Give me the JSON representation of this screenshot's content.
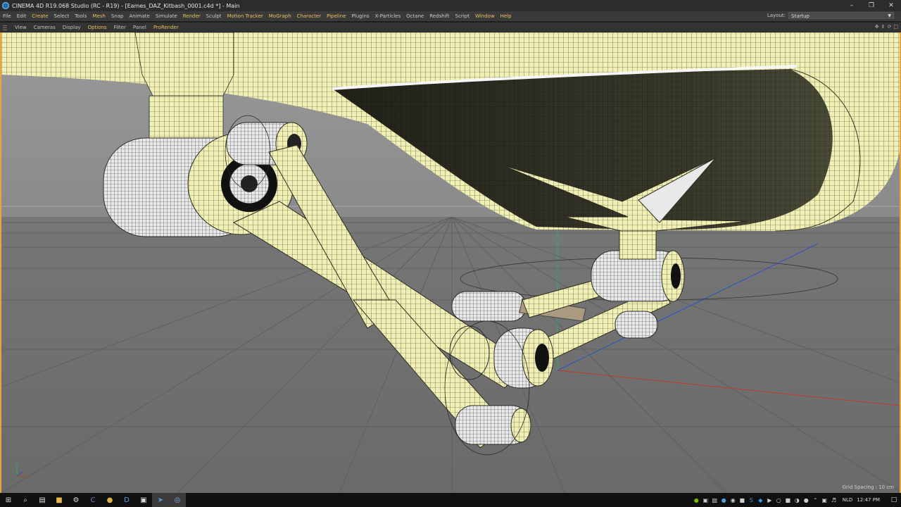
{
  "window": {
    "title": "CINEMA 4D R19.068 Studio (RC - R19) - [Eames_DAZ_Kitbash_0001.c4d *] - Main",
    "minimize": "–",
    "restore": "❐",
    "close": "✕"
  },
  "menubar": {
    "items": [
      "File",
      "Edit",
      "Create",
      "Select",
      "Tools",
      "Mesh",
      "Snap",
      "Animate",
      "Simulate",
      "Render",
      "Sculpt",
      "Motion Tracker",
      "MoGraph",
      "Character",
      "Pipeline",
      "Plugins",
      "X-Particles",
      "Octane",
      "Redshift",
      "Script",
      "Window",
      "Help"
    ],
    "layout_label": "Layout:",
    "layout_value": "Startup"
  },
  "viewport_menu": {
    "items": [
      "View",
      "Cameras",
      "Display",
      "Options",
      "Filter",
      "Panel",
      "ProRender"
    ]
  },
  "viewport": {
    "grid_spacing": "Grid Spacing : 10 cm",
    "axis_x_color": "#c0392b",
    "axis_y_color": "#27ae60",
    "axis_z_color": "#2f50c8",
    "mesh_color": "#f1f0b4"
  },
  "taskbar": {
    "apps": [
      {
        "name": "start-icon",
        "glyph": "⊞"
      },
      {
        "name": "search-icon",
        "glyph": "⌕"
      },
      {
        "name": "task-view-icon",
        "glyph": "▤"
      },
      {
        "name": "file-explorer-icon",
        "glyph": "■"
      },
      {
        "name": "settings-icon",
        "glyph": "⚙"
      },
      {
        "name": "app-c-icon",
        "glyph": "C"
      },
      {
        "name": "chrome-icon",
        "glyph": "●"
      },
      {
        "name": "daz-icon",
        "glyph": "D"
      },
      {
        "name": "window-app-icon",
        "glyph": "▣"
      },
      {
        "name": "telegram-icon",
        "glyph": "➤"
      },
      {
        "name": "cinema4d-icon",
        "glyph": "◎"
      }
    ],
    "tray_icons": [
      "nvidia-icon",
      "drive-icon",
      "app-icon",
      "app-icon",
      "steam-icon",
      "app-icon",
      "skype-icon",
      "dropbox-icon",
      "app-icon",
      "app-icon",
      "app-icon",
      "app-icon",
      "app-icon",
      "chevron-up-icon",
      "network-icon",
      "volume-icon"
    ],
    "language": "NLD",
    "time": "12:47 PM"
  }
}
